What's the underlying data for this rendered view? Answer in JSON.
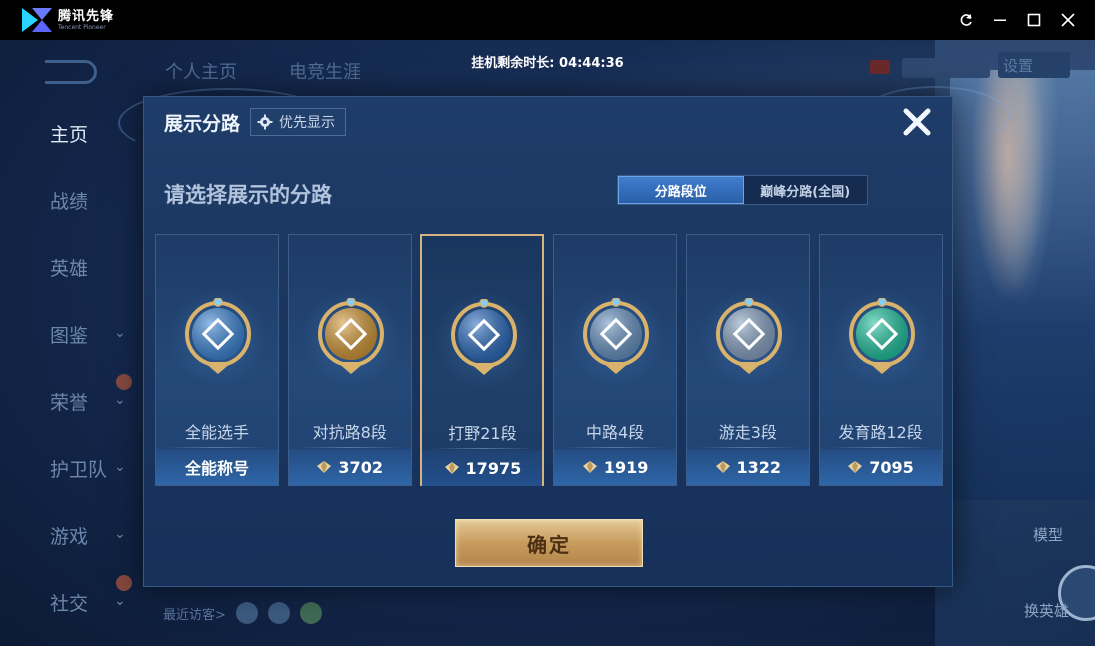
{
  "app": {
    "name_cn": "腾讯先锋",
    "name_en": "Tencent Pioneer"
  },
  "afk_timer": "挂机剩余时长: 04:44:36",
  "background": {
    "top_nav": [
      "个人主页",
      "电竞生涯"
    ],
    "settings_label": "设置",
    "sidebar": [
      {
        "label": "主页",
        "active": true,
        "chevron": false
      },
      {
        "label": "战绩",
        "active": false,
        "chevron": false
      },
      {
        "label": "英雄",
        "active": false,
        "chevron": false
      },
      {
        "label": "图鉴",
        "active": false,
        "chevron": true
      },
      {
        "label": "荣誉",
        "active": false,
        "chevron": true
      },
      {
        "label": "护卫队",
        "active": false,
        "chevron": true
      },
      {
        "label": "游戏",
        "active": false,
        "chevron": true
      },
      {
        "label": "社交",
        "active": false,
        "chevron": true
      }
    ],
    "recent_visitors": "最近访客>",
    "model_label": "模型",
    "swap_hero_label": "换英雄"
  },
  "modal": {
    "title": "展示分路",
    "priority_button": "优先显示",
    "subtitle": "请选择展示的分路",
    "tabs": [
      {
        "label": "分路段位",
        "active": true
      },
      {
        "label": "巅峰分路(全国)",
        "active": false
      }
    ],
    "cards": [
      {
        "role": "全能选手",
        "value": "全能称号",
        "has_diamond": false,
        "selected": false,
        "badge": "allround-badge-icon",
        "color": "#3f88d6"
      },
      {
        "role": "对抗路8段",
        "value": "3702",
        "has_diamond": true,
        "selected": false,
        "badge": "clash-lane-badge-icon",
        "color": "#d39a3a"
      },
      {
        "role": "打野21段",
        "value": "17975",
        "has_diamond": true,
        "selected": true,
        "badge": "jungle-badge-icon",
        "color": "#2f6fc0"
      },
      {
        "role": "中路4段",
        "value": "1919",
        "has_diamond": true,
        "selected": false,
        "badge": "mid-lane-badge-icon",
        "color": "#6a95c4"
      },
      {
        "role": "游走3段",
        "value": "1322",
        "has_diamond": true,
        "selected": false,
        "badge": "roam-badge-icon",
        "color": "#8aa4c4"
      },
      {
        "role": "发育路12段",
        "value": "7095",
        "has_diamond": true,
        "selected": false,
        "badge": "farm-lane-badge-icon",
        "color": "#23c4a0"
      }
    ],
    "confirm_button": "确定"
  }
}
